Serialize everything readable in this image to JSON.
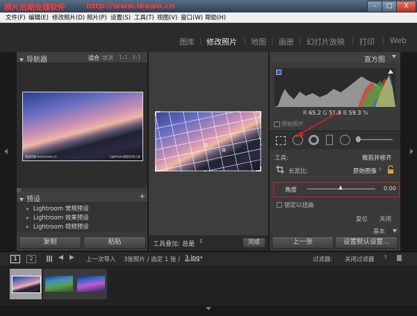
{
  "titlebar": {
    "title": "照片后期处理软件",
    "url": "http://www.leawo.cn",
    "minimize": "–",
    "maximize": "□",
    "close": "X"
  },
  "menu": [
    "文件(F)",
    "编辑(E)",
    "修改照片(D)",
    "照片(P)",
    "设置(S)",
    "工具(T)",
    "视图(V)",
    "窗口(W)",
    "帮助(H)"
  ],
  "modules": [
    "图库",
    "修改照片",
    "地图",
    "画册",
    "幻灯片放映",
    "打印",
    "Web"
  ],
  "navigator": {
    "title": "导航器",
    "zoom": [
      "适合",
      "填满",
      "1:1",
      "3:1"
    ],
    "thumb_caption_left": "我爱拍摄 www.leawo.cn",
    "thumb_caption_right": "Lightroom裁剪拉直工具"
  },
  "presets": {
    "title": "预设",
    "add": "+",
    "items": [
      "Lightroom 常规预设",
      "Lightroom 效果预设",
      "Lightroom 视频预设"
    ]
  },
  "left_buttons": {
    "copy": "复制",
    "paste": "粘贴"
  },
  "toolbar": {
    "overlay_label": "工具叠加:",
    "overlay_value": "总是",
    "done": "完成"
  },
  "histogram": {
    "title": "直方图",
    "r_label": "R",
    "r_value": "65.2",
    "g_label": "G",
    "g_value": "51.8",
    "b_label": "B",
    "b_value": "59.3",
    "percent": "%",
    "original_photo": "原始照片"
  },
  "crop": {
    "tool_label": "工具:",
    "tool_name": "裁剪并修齐",
    "aspect_label": "长宽比:",
    "aspect_value": "原始图像",
    "angle_label": "角度",
    "angle_value": "0.00",
    "constrain_label": "锁定以扭曲",
    "reset": "复位",
    "close": "关闭",
    "basic": "基本"
  },
  "right_buttons": {
    "previous": "上一张",
    "set_default": "设置默认设置..."
  },
  "filmstrip": {
    "page1": "1",
    "page2": "2",
    "source": "上一次导入",
    "count": "3张照片 / 选定 1 张 /",
    "filename": "3.jpg",
    "filter_label": "过滤器:",
    "filter_value": "关闭过滤器"
  },
  "colors": {
    "accent_red": "#d42020",
    "title_red": "#ff3a3a"
  }
}
